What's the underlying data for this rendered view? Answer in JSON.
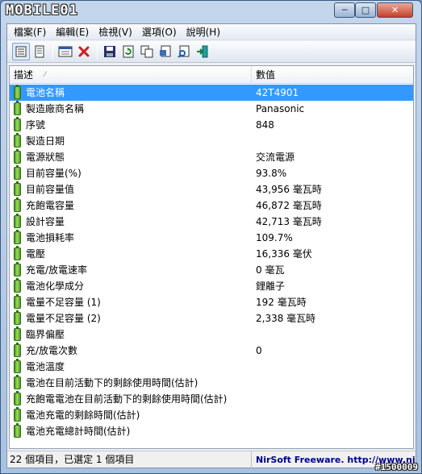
{
  "window": {
    "logo_text": "MOBILE01",
    "controls": {
      "minimize": "─",
      "maximize": "□",
      "close": "✕"
    }
  },
  "menu": [
    {
      "label": "檔案(F)"
    },
    {
      "label": "編輯(E)"
    },
    {
      "label": "檢視(V)"
    },
    {
      "label": "選項(O)"
    },
    {
      "label": "說明(H)"
    }
  ],
  "toolbar": {
    "icons": [
      "view-details-icon",
      "view-list-icon",
      "properties-window-icon",
      "delete-icon",
      "save-icon",
      "refresh-icon",
      "copy-icon",
      "html-report-icon",
      "find-icon",
      "exit-icon"
    ]
  },
  "list": {
    "columns": {
      "desc": "描述",
      "value": "數值"
    },
    "rows": [
      {
        "desc": "電池名稱",
        "value": "42T4901"
      },
      {
        "desc": "製造廠商名稱",
        "value": "Panasonic"
      },
      {
        "desc": "序號",
        "value": " 848"
      },
      {
        "desc": "製造日期",
        "value": ""
      },
      {
        "desc": "電源狀態",
        "value": "交流電源"
      },
      {
        "desc": "目前容量(%)",
        "value": "93.8%"
      },
      {
        "desc": "目前容量值",
        "value": "43,956 毫瓦時"
      },
      {
        "desc": "充飽電容量",
        "value": "46,872 毫瓦時"
      },
      {
        "desc": "設計容量",
        "value": "42,713 毫瓦時"
      },
      {
        "desc": "電池損耗率",
        "value": "109.7%"
      },
      {
        "desc": "電壓",
        "value": "16,336 毫伏"
      },
      {
        "desc": "充電/放電速率",
        "value": "0 毫瓦"
      },
      {
        "desc": "電池化學成分",
        "value": "鋰離子"
      },
      {
        "desc": "電量不足容量 (1)",
        "value": "192 毫瓦時"
      },
      {
        "desc": "電量不足容量 (2)",
        "value": "2,338 毫瓦時"
      },
      {
        "desc": "臨界偏壓",
        "value": ""
      },
      {
        "desc": "充/放電次數",
        "value": "0"
      },
      {
        "desc": "電池溫度",
        "value": ""
      },
      {
        "desc": "電池在目前活動下的剩餘使用時間(估計)",
        "value": ""
      },
      {
        "desc": "充飽電電池在目前活動下的剩餘使用時間(估計)",
        "value": ""
      },
      {
        "desc": "電池充電的剩餘時間(估計)",
        "value": ""
      },
      {
        "desc": "電池充電總計時間(估計)",
        "value": ""
      }
    ]
  },
  "status": {
    "left": "22 個項目，已選定 1 個項目",
    "right": "NirSoft Freeware.  http://www.nirsoft.net"
  },
  "watermark": "#1500009",
  "colors": {
    "selection": "#3399ff",
    "link": "#00008b"
  }
}
